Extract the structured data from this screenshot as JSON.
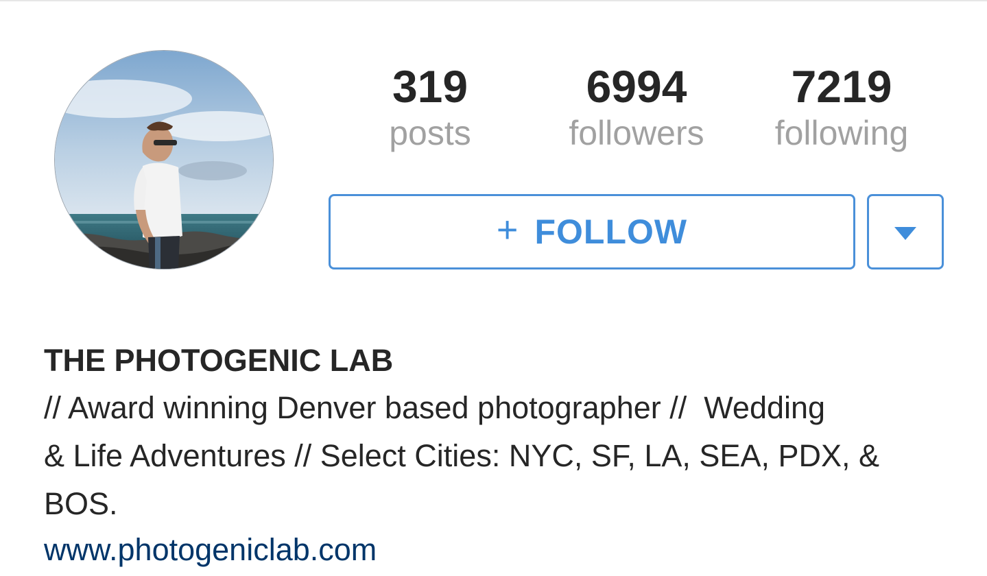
{
  "stats": {
    "posts": {
      "count": "319",
      "label": "posts"
    },
    "followers": {
      "count": "6994",
      "label": "followers"
    },
    "following": {
      "count": "7219",
      "label": "following"
    }
  },
  "actions": {
    "follow_icon": "plus-icon",
    "follow_symbol": "+",
    "follow_label": "FOLLOW",
    "more_icon": "caret-down-icon"
  },
  "profile": {
    "avatar": "profile-photo",
    "name": "THE PHOTOGENIC LAB",
    "bio_lines": [
      "// Award winning Denver based photographer //  Wedding",
      "& Life Adventures // Select Cities: NYC, SF, LA, SEA, PDX, &",
      "BOS."
    ],
    "website": "www.photogeniclab.com"
  },
  "colors": {
    "accent": "#3f8ddb",
    "text": "#262626",
    "muted": "#a1a1a1",
    "link": "#003569"
  }
}
